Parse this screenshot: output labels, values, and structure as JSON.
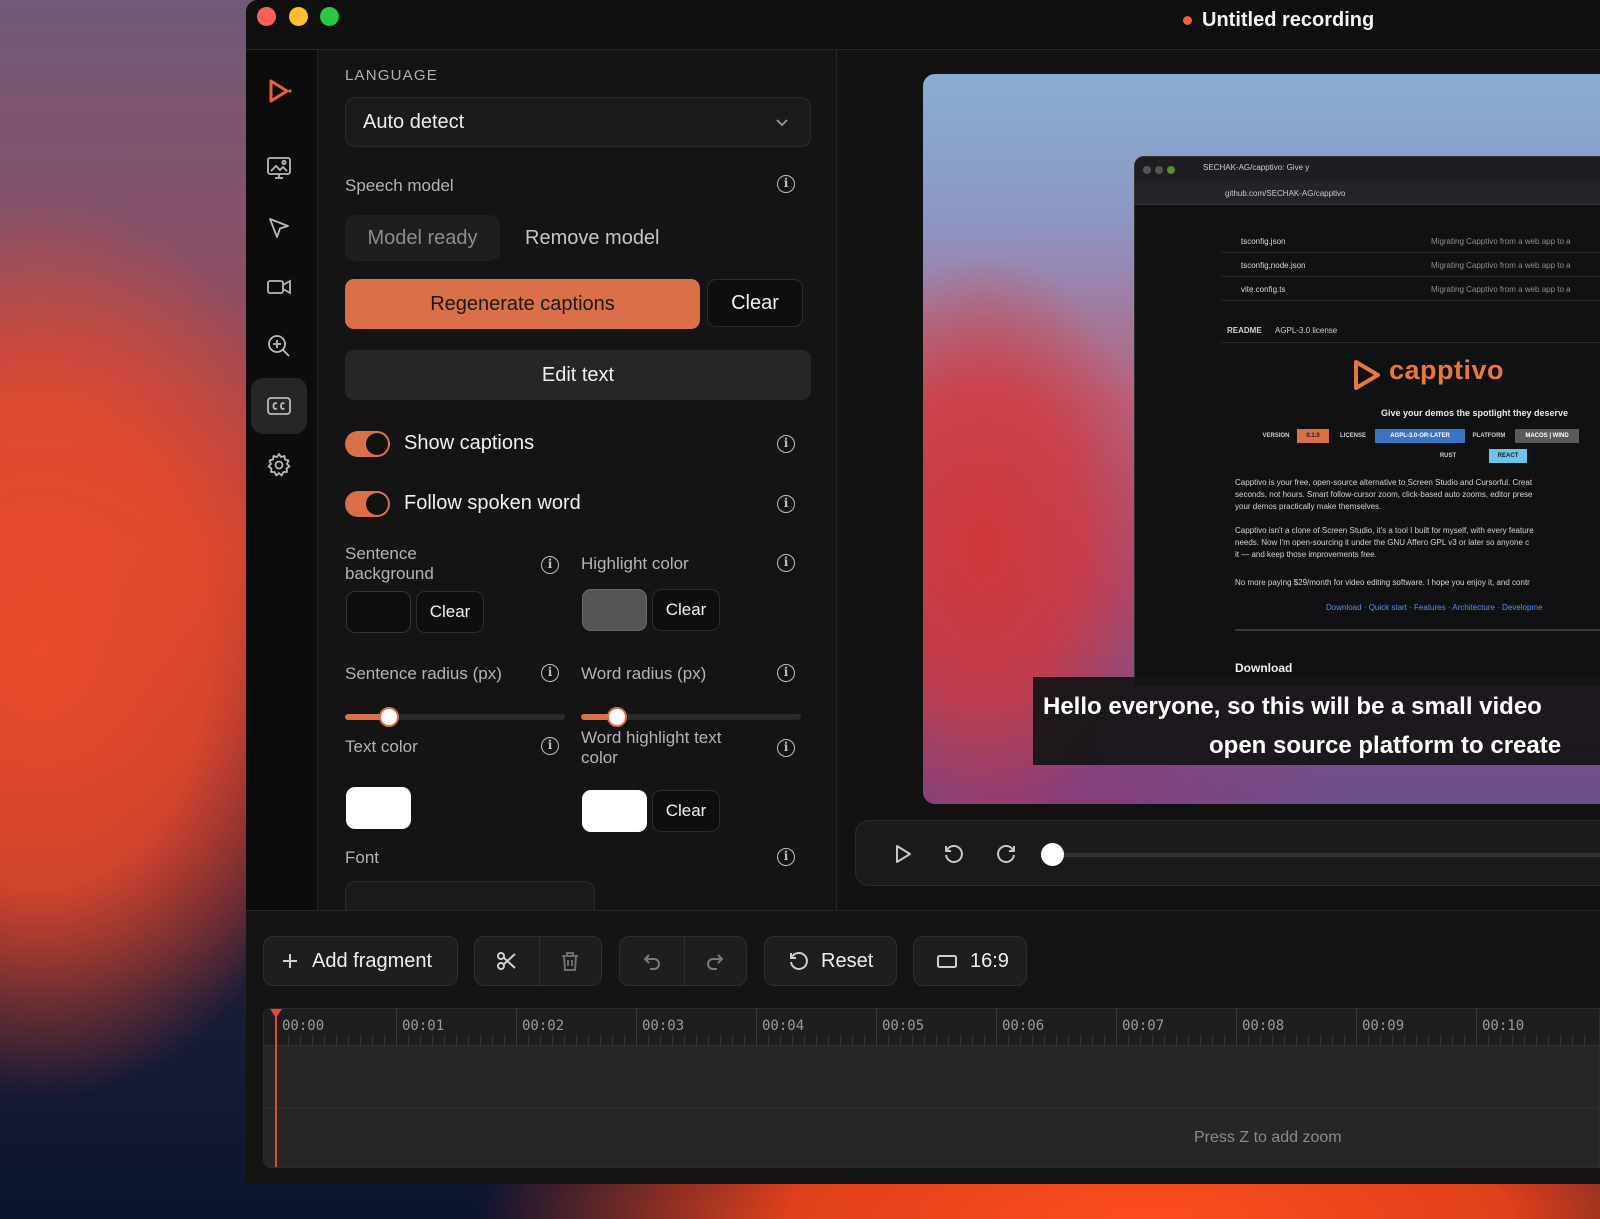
{
  "window": {
    "title": "Untitled recording"
  },
  "rail": {
    "items": [
      {
        "icon": "logo-icon"
      },
      {
        "icon": "background-image-icon"
      },
      {
        "icon": "cursor-icon"
      },
      {
        "icon": "camera-icon"
      },
      {
        "icon": "zoom-icon"
      },
      {
        "icon": "captions-icon",
        "active": true
      },
      {
        "icon": "gear-icon"
      }
    ]
  },
  "panel": {
    "language_label": "LANGUAGE",
    "language_value": "Auto detect",
    "speech_model_label": "Speech model",
    "model_ready": "Model ready",
    "remove_model": "Remove model",
    "regenerate": "Regenerate captions",
    "clear": "Clear",
    "edit_text": "Edit text",
    "show_captions": "Show captions",
    "show_captions_on": true,
    "follow_spoken_word": "Follow spoken word",
    "follow_spoken_word_on": true,
    "sentence_background": "Sentence background",
    "sentence_background_color": "#0e0e0e",
    "sentence_background_clear": "Clear",
    "highlight_color": "Highlight color",
    "highlight_color_value": "#555555",
    "highlight_color_clear": "Clear",
    "sentence_radius": "Sentence radius (px)",
    "sentence_radius_fraction": 0.2,
    "word_radius": "Word radius (px)",
    "word_radius_fraction": 0.16,
    "text_color": "Text color",
    "text_color_value": "#ffffff",
    "word_highlight_text_color": "Word highlight text color",
    "word_highlight_text_color_value": "#ffffff",
    "word_highlight_clear": "Clear",
    "font": "Font",
    "accent_color": "#d9704a"
  },
  "preview": {
    "inner": {
      "tab_title": "SECHAK-AG/capptivo: Give y",
      "url": "github.com/SECHAK-AG/capptivo",
      "files": [
        {
          "name": "tsconfig.json",
          "message": "Migrating Capptivo from a web app to a"
        },
        {
          "name": "tsconfig.node.json",
          "message": "Migrating Capptivo from a web app to a"
        },
        {
          "name": "vite.config.ts",
          "message": "Migrating Capptivo from a web app to a"
        }
      ],
      "readme_tab": "README",
      "license_tab": "AGPL-3.0 license",
      "logo": "capptivo",
      "tagline": "Give your demos the spotlight they deserve",
      "badges": {
        "version_label": "VERSION",
        "version_value": "0.1.0",
        "license_label": "LICENSE",
        "license_value": "AGPL-3.0-OR-LATER",
        "platform_label": "PLATFORM",
        "platform_value": "MACOS | WIND",
        "rust": "RUST",
        "react": "REACT"
      },
      "para1a": "Capptivo is your free, open-source alternative to Screen Studio and Cursorful. Creat",
      "para1b": "seconds, not hours. Smart follow-cursor zoom, click-based auto zooms, editor prese",
      "para1c": "your demos practically make themselves.",
      "para2a": "Capptivo isn't a clone of Screen Studio, it's a tool I built for myself, with every feature",
      "para2b": "needs. Now I'm open-sourcing it under the GNU Affero GPL v3 or later so anyone c",
      "para2c": "it — and keep those improvements free.",
      "para3": "No more paying $29/month for video editing software. I hope you enjoy it, and contr",
      "links": "Download · Quick start · Features · Architecture · Developme",
      "download_heading": "Download"
    },
    "caption_line1": "Hello everyone, so this will be a small video",
    "caption_line2": "open source platform to create"
  },
  "toolbar": {
    "add_fragment": "Add fragment",
    "reset": "Reset",
    "aspect_ratio": "16:9"
  },
  "timeline": {
    "ticks": [
      "00:00",
      "00:01",
      "00:02",
      "00:03",
      "00:04",
      "00:05",
      "00:06",
      "00:07",
      "00:08",
      "00:09",
      "00:10"
    ],
    "hint": "Press Z to add zoom"
  }
}
